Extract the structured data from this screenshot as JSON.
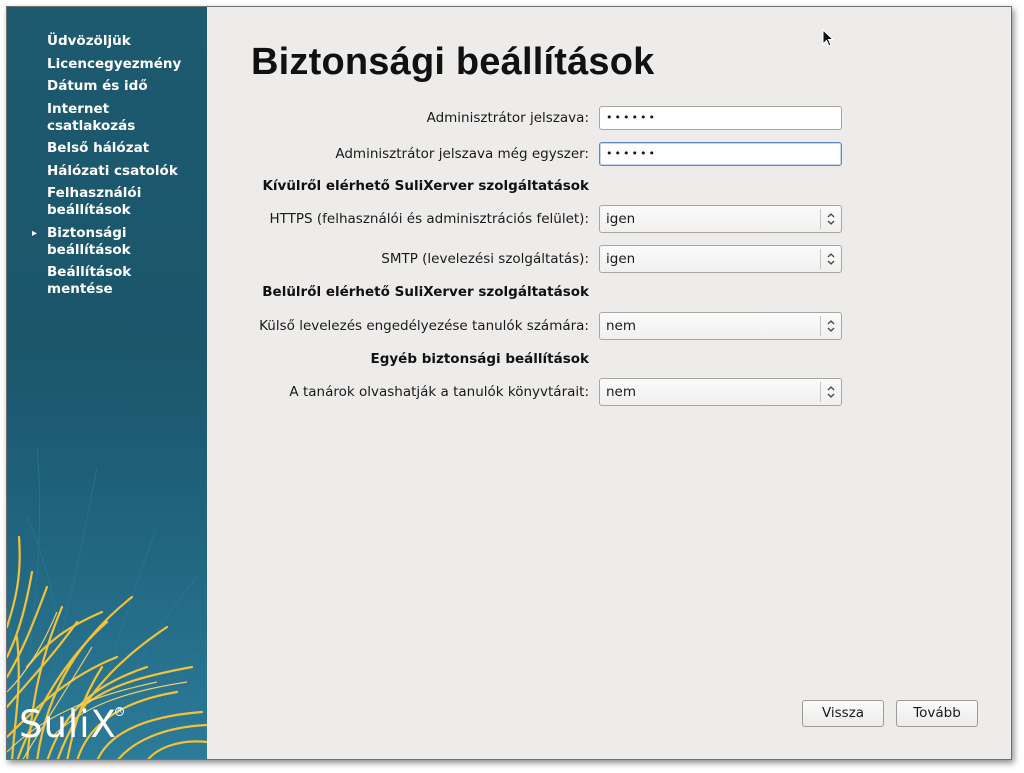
{
  "sidebar": {
    "items": [
      {
        "label": "Üdvözöljük",
        "active": false
      },
      {
        "label": "Licencegyezmény",
        "active": false
      },
      {
        "label": "Dátum és idő",
        "active": false
      },
      {
        "label": "Internet\ncsatlakozás",
        "active": false
      },
      {
        "label": "Belső hálózat",
        "active": false
      },
      {
        "label": "Hálózati csatolók",
        "active": false
      },
      {
        "label": "Felhasználói\nbeállítások",
        "active": false
      },
      {
        "label": "Biztonsági\nbeállítások",
        "active": true
      },
      {
        "label": "Beállítások\nmentése",
        "active": false
      }
    ],
    "active_marker": "▸",
    "logo_text": "SuliX",
    "logo_mark": "R"
  },
  "main": {
    "title": "Biztonsági beállítások",
    "admin_password": {
      "label": "Adminisztrátor jelszava:",
      "value": "••••••"
    },
    "admin_password_confirm": {
      "label": "Adminisztrátor jelszava még egyszer:",
      "value": "••••••"
    },
    "section_external": "Kívülről elérhető SuliXerver szolgáltatások",
    "https": {
      "label": "HTTPS (felhasználói és adminisztrációs felület):",
      "value": "igen"
    },
    "smtp": {
      "label": "SMTP (levelezési szolgáltatás):",
      "value": "igen"
    },
    "section_internal": "Belülről elérhető SuliXerver szolgáltatások",
    "external_mail": {
      "label": "Külső levelezés engedélyezése tanulók számára:",
      "value": "nem"
    },
    "section_other": "Egyéb biztonsági beállítások",
    "teachers_read": {
      "label": "A tanárok olvashatják a tanulók könyvtárait:",
      "value": "nem"
    }
  },
  "buttons": {
    "back": "Vissza",
    "next": "Tovább"
  },
  "colors": {
    "sidebar_bg": "#1d5a70",
    "content_bg": "#edeceb",
    "grass_yellow": "#f2c23a",
    "focus_border": "#5f88b8"
  }
}
